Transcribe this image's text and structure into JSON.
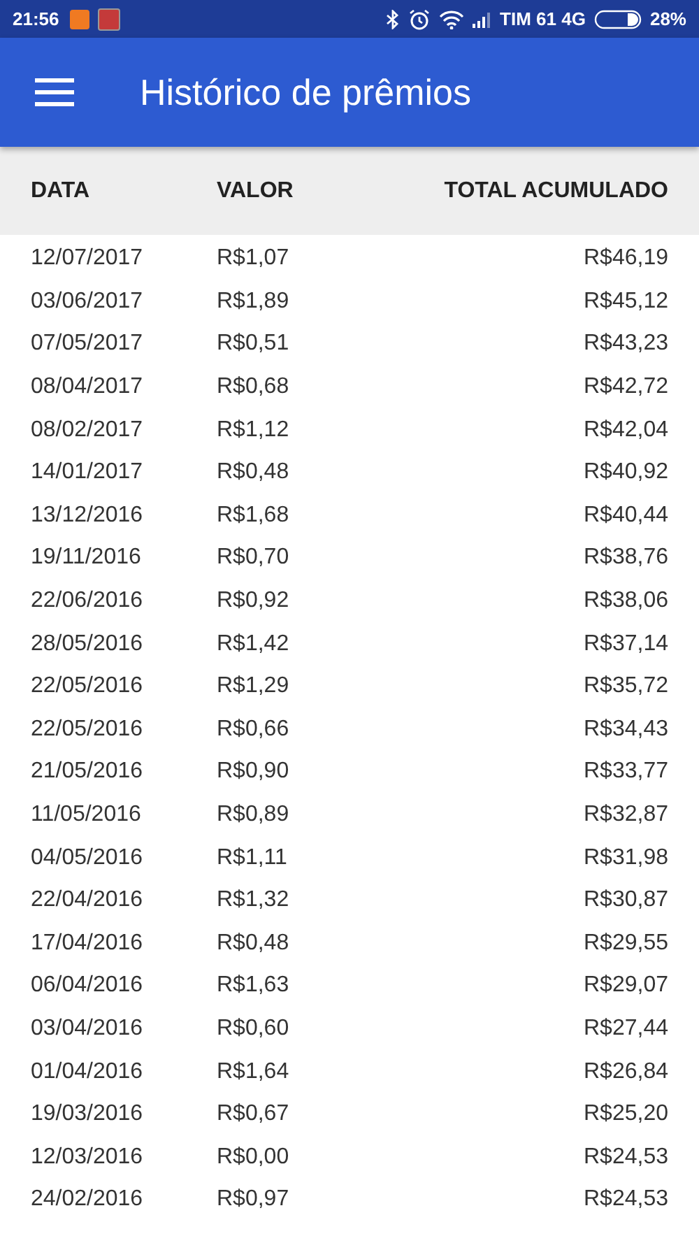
{
  "status_bar": {
    "time": "21:56",
    "carrier": "TIM 61 4G",
    "battery": "28%"
  },
  "app_bar": {
    "title": "Histórico de prêmios"
  },
  "table": {
    "columns": [
      "DATA",
      "VALOR",
      "TOTAL ACUMULADO"
    ],
    "rows": [
      [
        "12/07/2017",
        "R$1,07",
        "R$46,19"
      ],
      [
        "03/06/2017",
        "R$1,89",
        "R$45,12"
      ],
      [
        "07/05/2017",
        "R$0,51",
        "R$43,23"
      ],
      [
        "08/04/2017",
        "R$0,68",
        "R$42,72"
      ],
      [
        "08/02/2017",
        "R$1,12",
        "R$42,04"
      ],
      [
        "14/01/2017",
        "R$0,48",
        "R$40,92"
      ],
      [
        "13/12/2016",
        "R$1,68",
        "R$40,44"
      ],
      [
        "19/11/2016",
        "R$0,70",
        "R$38,76"
      ],
      [
        "22/06/2016",
        "R$0,92",
        "R$38,06"
      ],
      [
        "28/05/2016",
        "R$1,42",
        "R$37,14"
      ],
      [
        "22/05/2016",
        "R$1,29",
        "R$35,72"
      ],
      [
        "22/05/2016",
        "R$0,66",
        "R$34,43"
      ],
      [
        "21/05/2016",
        "R$0,90",
        "R$33,77"
      ],
      [
        "11/05/2016",
        "R$0,89",
        "R$32,87"
      ],
      [
        "04/05/2016",
        "R$1,11",
        "R$31,98"
      ],
      [
        "22/04/2016",
        "R$1,32",
        "R$30,87"
      ],
      [
        "17/04/2016",
        "R$0,48",
        "R$29,55"
      ],
      [
        "06/04/2016",
        "R$1,63",
        "R$29,07"
      ],
      [
        "03/04/2016",
        "R$0,60",
        "R$27,44"
      ],
      [
        "01/04/2016",
        "R$1,64",
        "R$26,84"
      ],
      [
        "19/03/2016",
        "R$0,67",
        "R$25,20"
      ],
      [
        "12/03/2016",
        "R$0,00",
        "R$24,53"
      ],
      [
        "24/02/2016",
        "R$0,97",
        "R$24,53"
      ]
    ]
  }
}
